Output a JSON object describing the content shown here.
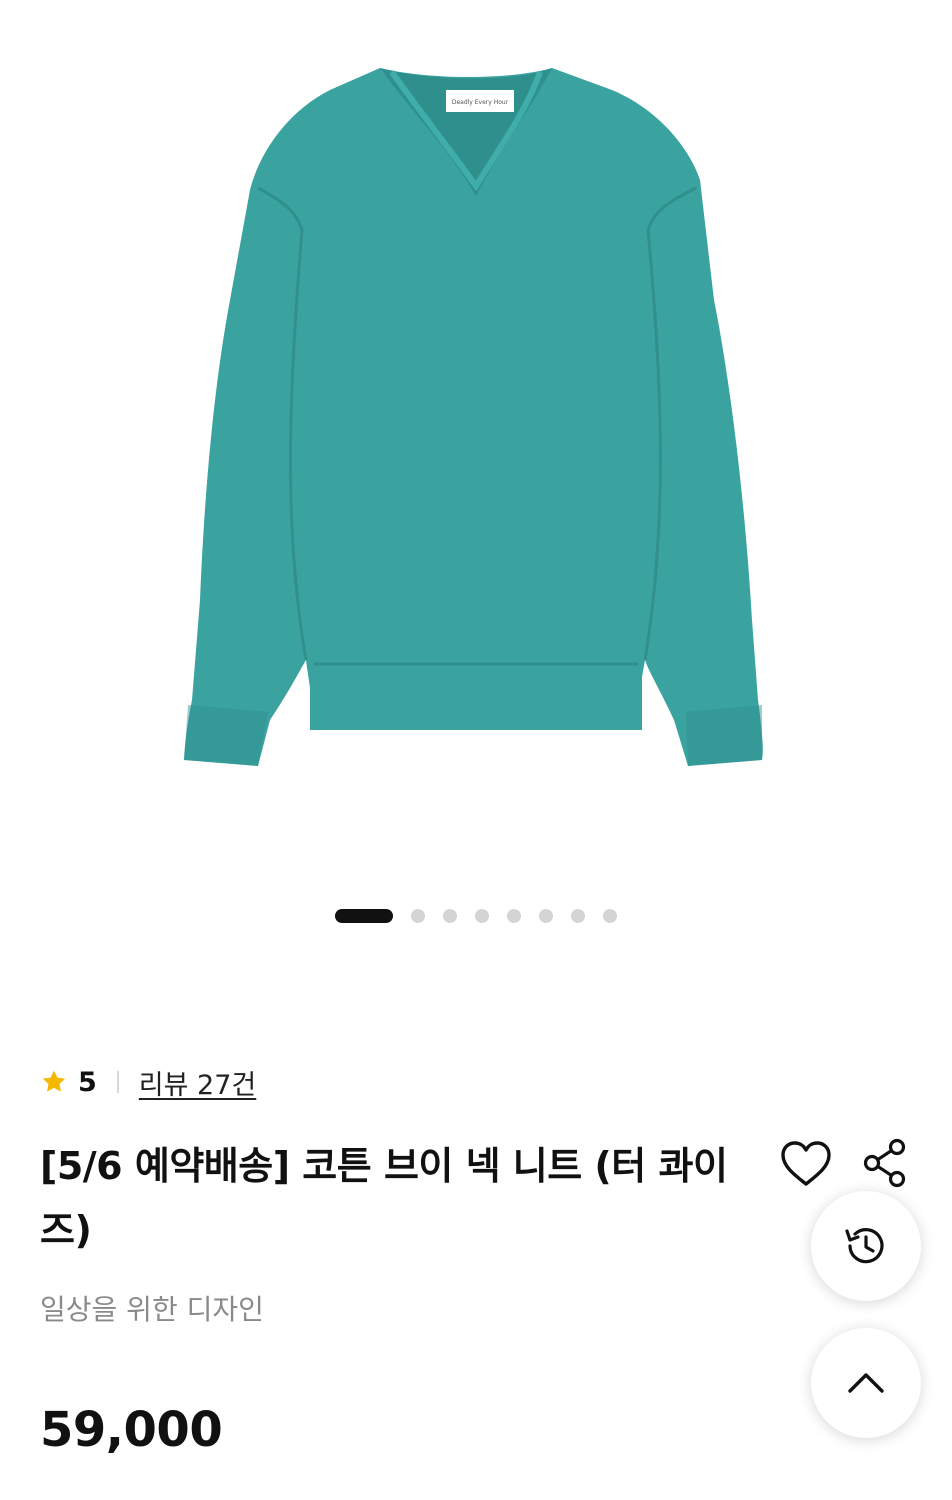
{
  "gallery": {
    "image_alt": "V-neck knit sweater, turquoise",
    "product_color": "#3aa3a0",
    "label_text": "Deadly Every Hour",
    "current_slide": 1,
    "total_slides": 8
  },
  "rating": {
    "score": "5",
    "reviews_link": "리뷰 27건",
    "star_color": "#f5b800"
  },
  "product": {
    "title": "[5/6 예약배송] 코튼 브이 넥 니트 (터 콰이즈)",
    "subtitle": "일상을 위한 디자인",
    "price": "59,000"
  },
  "icons": {
    "wishlist": "heart-outline-icon",
    "share": "share-icon",
    "history": "history-icon",
    "scroll_top": "chevron-up-icon"
  }
}
